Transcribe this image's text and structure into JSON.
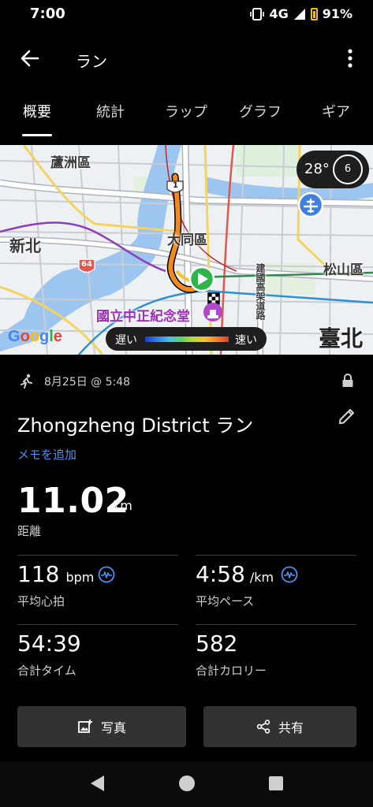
{
  "status_bar": {
    "time": "7:00",
    "network": "4G",
    "battery": "91%"
  },
  "header": {
    "title": "ラン"
  },
  "tabs": [
    {
      "label": "概要",
      "active": true
    },
    {
      "label": "統計",
      "active": false
    },
    {
      "label": "ラップ",
      "active": false
    },
    {
      "label": "グラフ",
      "active": false
    },
    {
      "label": "ギア",
      "active": false
    }
  ],
  "map": {
    "labels": {
      "luzhou": "蘆洲區",
      "xinbei": "新北",
      "datong": "大同區",
      "songshan": "松山區",
      "cks": "國立中正紀念堂",
      "jianguo": "建國高架道路",
      "taipei": "臺北",
      "shield_64": "64",
      "shield_1": "1"
    },
    "google": "Google",
    "weather": {
      "temp": "28°",
      "wind": "6"
    },
    "legend": {
      "slow": "遅い",
      "fast": "速い"
    }
  },
  "activity": {
    "datetime": "8月25日 @ 5:48",
    "title": "Zhongzheng District ラン",
    "memo_link": "メモを追加"
  },
  "stats": {
    "distance": {
      "value": "11.02",
      "unit": "km",
      "label": "距離"
    },
    "heart_rate": {
      "value": "118",
      "unit": "bpm",
      "label": "平均心拍"
    },
    "pace": {
      "value": "4:58",
      "unit": "/km",
      "label": "平均ペース"
    },
    "time": {
      "value": "54:39",
      "label": "合計タイム"
    },
    "calories": {
      "value": "582",
      "label": "合計カロリー"
    }
  },
  "buttons": {
    "photo": "写真",
    "share": "共有"
  },
  "colors": {
    "accent_blue": "#4f8ff0",
    "route_orange": "#f28a1e",
    "start_green": "#2fb34a"
  }
}
